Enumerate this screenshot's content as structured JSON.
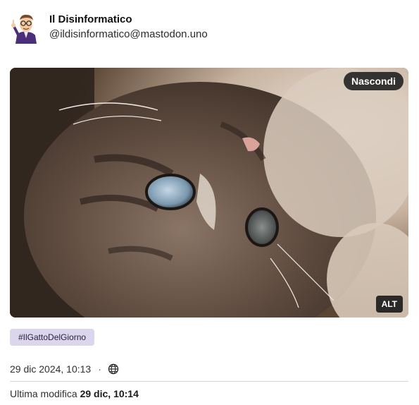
{
  "author": {
    "display_name": "Il Disinformatico",
    "handle": "@ildisinformatico@mastodon.uno",
    "avatar_icon": "cartoon-avatar-icon"
  },
  "media": {
    "description_icon": "cat-photo",
    "hide_label": "Nascondi",
    "alt_label": "ALT"
  },
  "hashtag": "#IlGattoDelGiorno",
  "meta": {
    "timestamp": "29 dic 2024, 10:13",
    "separator": "·",
    "visibility_icon": "globe-icon"
  },
  "edited": {
    "prefix": "Ultima modifica",
    "value": "29 dic, 10:14"
  },
  "colors": {
    "hashtag_bg": "#dcd6ec",
    "overlay_bg": "#1e1e1e"
  }
}
